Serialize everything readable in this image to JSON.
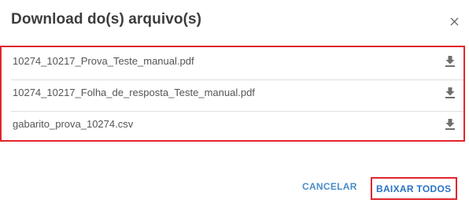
{
  "dialog": {
    "title": "Download do(s) arquivo(s)",
    "close_icon": "close-icon"
  },
  "files": [
    {
      "name": "10274_10217_Prova_Teste_manual.pdf",
      "icon": "download-icon"
    },
    {
      "name": "10274_10217_Folha_de_resposta_Teste_manual.pdf",
      "icon": "download-icon"
    },
    {
      "name": "gabarito_prova_10274.csv",
      "icon": "download-icon"
    }
  ],
  "actions": {
    "cancel_label": "CANCELAR",
    "download_all_label": "BAIXAR TODOS"
  },
  "colors": {
    "accent": "#2a73c4",
    "highlight_border": "#e0262e",
    "title_text": "#3d3d3d",
    "file_text": "#555555"
  }
}
